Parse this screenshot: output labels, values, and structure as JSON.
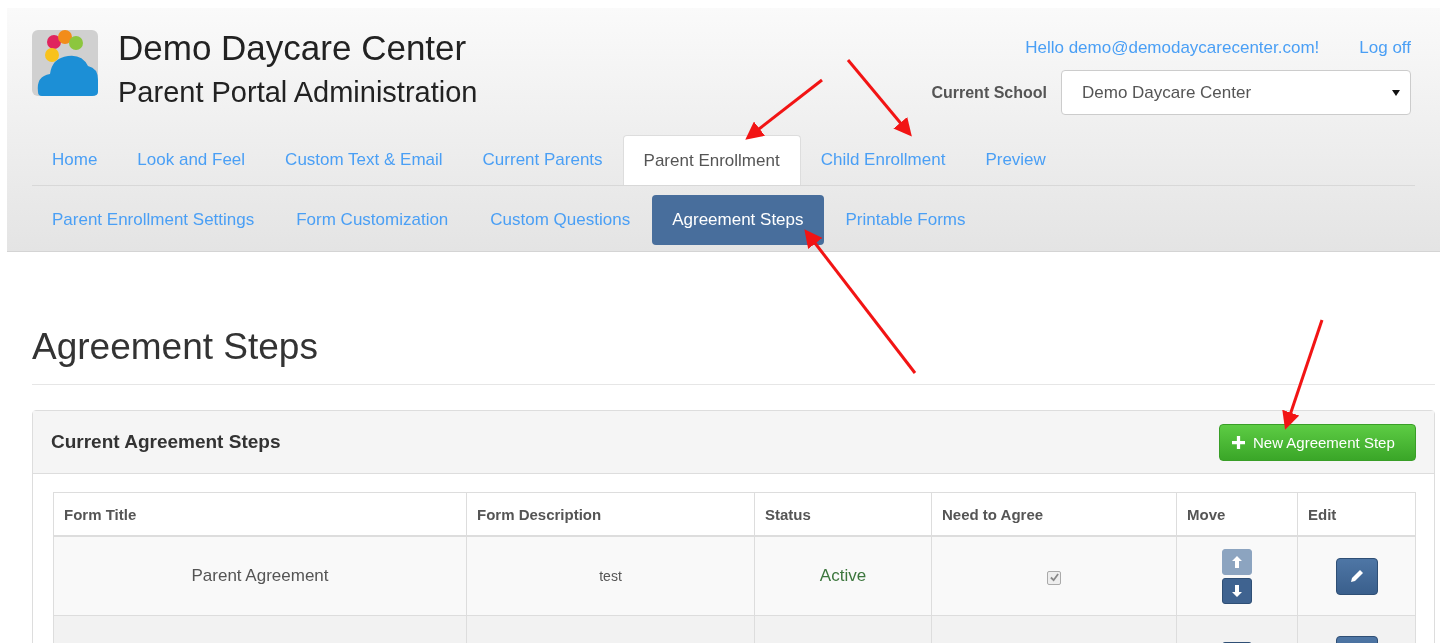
{
  "header": {
    "title": "Demo Daycare Center",
    "subtitle": "Parent Portal Administration",
    "greeting": "Hello demo@demodaycarecenter.com!",
    "logoff": "Log off",
    "school_label": "Current School",
    "school_value": "Demo Daycare Center"
  },
  "tabs": [
    {
      "label": "Home",
      "selected": false
    },
    {
      "label": "Look and Feel",
      "selected": false
    },
    {
      "label": "Custom Text & Email",
      "selected": false
    },
    {
      "label": "Current Parents",
      "selected": false
    },
    {
      "label": "Parent Enrollment",
      "selected": true
    },
    {
      "label": "Child Enrollment",
      "selected": false
    },
    {
      "label": "Preview",
      "selected": false
    }
  ],
  "subtabs": [
    {
      "label": "Parent Enrollment Settings",
      "selected": false
    },
    {
      "label": "Form Customization",
      "selected": false
    },
    {
      "label": "Custom Questions",
      "selected": false
    },
    {
      "label": "Agreement Steps",
      "selected": true
    },
    {
      "label": "Printable Forms",
      "selected": false
    }
  ],
  "page_title": "Agreement Steps",
  "panel": {
    "title": "Current Agreement Steps",
    "button": "New Agreement Step"
  },
  "table": {
    "columns": [
      "Form Title",
      "Form Description",
      "Status",
      "Need to Agree",
      "Move",
      "Edit"
    ],
    "rows": [
      {
        "title": "Parent Agreement",
        "description": "test",
        "status": "Active",
        "need_to_agree": true,
        "up_disabled": true,
        "down_disabled": false
      },
      {
        "up_disabled": false
      }
    ]
  }
}
